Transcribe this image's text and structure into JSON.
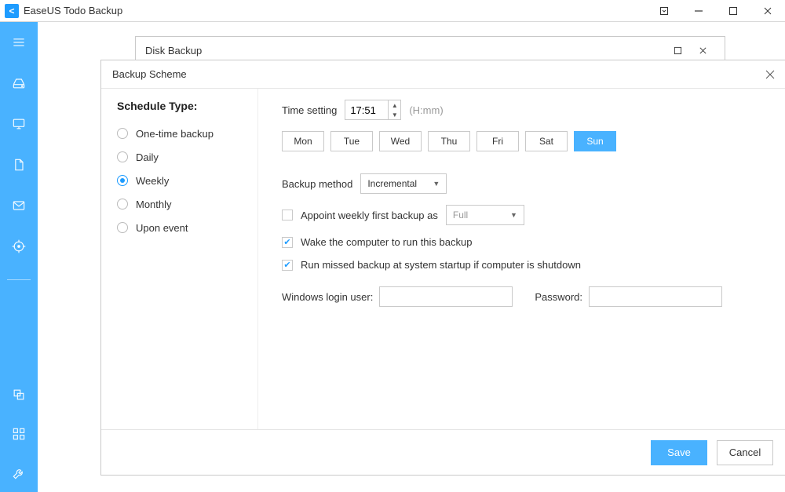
{
  "app": {
    "title": "EaseUS Todo Backup"
  },
  "subwindow": {
    "title": "Disk Backup"
  },
  "dialog": {
    "title": "Backup Scheme",
    "save": "Save",
    "cancel": "Cancel"
  },
  "schedule": {
    "heading": "Schedule Type:",
    "options": {
      "one_time": "One-time backup",
      "daily": "Daily",
      "weekly": "Weekly",
      "monthly": "Monthly",
      "upon_event": "Upon event"
    },
    "selected": "weekly"
  },
  "settings": {
    "time_label": "Time setting",
    "time_value": "17:51",
    "time_hint": "(H:mm)",
    "days": {
      "mon": "Mon",
      "tue": "Tue",
      "wed": "Wed",
      "thu": "Thu",
      "fri": "Fri",
      "sat": "Sat",
      "sun": "Sun"
    },
    "selected_day": "sun",
    "method_label": "Backup method",
    "method_value": "Incremental",
    "appoint_label": "Appoint weekly first backup as",
    "appoint_value": "Full",
    "appoint_checked": false,
    "wake_label": "Wake the computer to run this backup",
    "wake_checked": true,
    "missed_label": "Run missed backup at system startup if computer is shutdown",
    "missed_checked": true,
    "login_label": "Windows login user:",
    "password_label": "Password:"
  },
  "sidebar_icons": {
    "menu": "menu-icon",
    "disk": "drive-icon",
    "system": "monitor-icon",
    "file": "file-icon",
    "mail": "mail-icon",
    "target": "target-icon",
    "clone": "clone-icon",
    "tiles": "tiles-icon",
    "tool": "wrench-icon"
  }
}
